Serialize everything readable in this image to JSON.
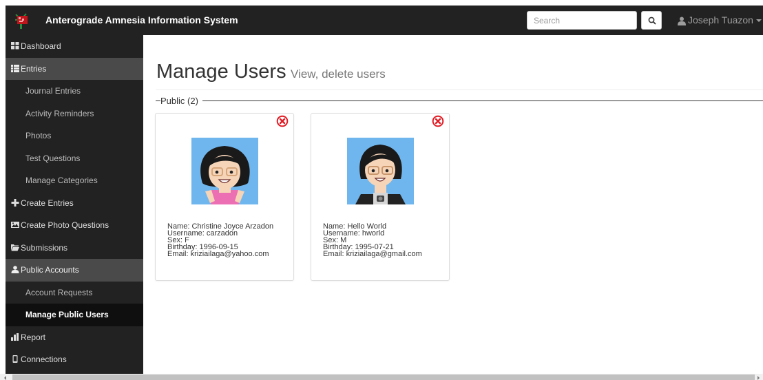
{
  "navbar": {
    "logo_icon": "brain-tree-logo",
    "title": "Anterograde Amnesia Information System",
    "search_placeholder": "Search",
    "search_icon": "search-icon",
    "user_name": "Joseph Tuazon",
    "bg_color": "#222222"
  },
  "sidebar": {
    "items": [
      {
        "label": "Dashboard",
        "icon": "dashboard-icon"
      },
      {
        "label": "Entries",
        "icon": "list-icon"
      },
      {
        "label": "Journal Entries"
      },
      {
        "label": "Activity Reminders"
      },
      {
        "label": "Photos"
      },
      {
        "label": "Test Questions"
      },
      {
        "label": "Manage Categories"
      },
      {
        "label": "Create Entries",
        "icon": "plus-icon"
      },
      {
        "label": "Create Photo Questions",
        "icon": "picture-icon"
      },
      {
        "label": "Submissions",
        "icon": "folder-open-icon"
      },
      {
        "label": "Public Accounts",
        "icon": "user-icon"
      },
      {
        "label": "Account Requests"
      },
      {
        "label": "Manage Public Users"
      },
      {
        "label": "Report",
        "icon": "bar-chart-icon"
      },
      {
        "label": "Connections",
        "icon": "phone-icon"
      }
    ],
    "active_item": "Manage Public Users",
    "expanded_section": "Public Accounts"
  },
  "main": {
    "title": "Manage Users",
    "subtitle": "View, delete users",
    "section_legend": "Public (2)",
    "users": [
      {
        "avatar": "female-cartoon-avatar",
        "name": "Name: Christine Joyce Arzadon",
        "username": "Username: carzadon",
        "sex": "Sex: F",
        "birthday": "Birthday: 1996-09-15",
        "email": "Email: kriziailaga@yahoo.com"
      },
      {
        "avatar": "male-cartoon-avatar",
        "name": "Name: Hello World",
        "username": "Username: hworld",
        "sex": "Sex: M",
        "birthday": "Birthday: 1995-07-21",
        "email": "Email: kriziailaga@gmail.com"
      }
    ],
    "delete_icon": "remove-circle-icon",
    "delete_color": "#e01b24",
    "avatar_bg_color": "#6fb6ee"
  }
}
